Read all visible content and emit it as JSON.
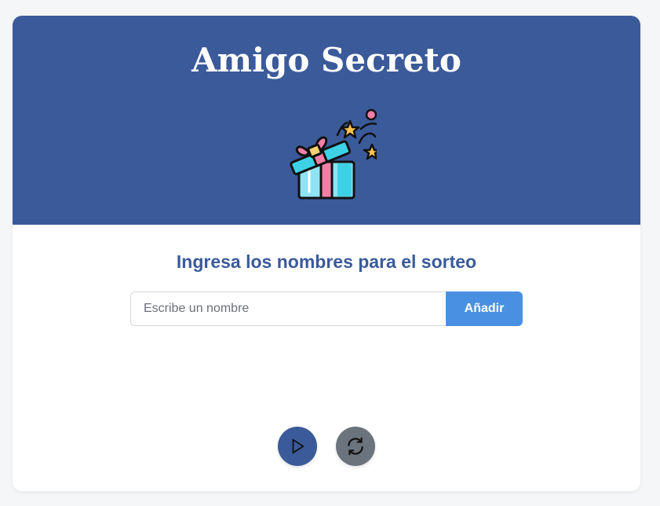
{
  "header": {
    "title": "Amigo Secreto",
    "image_icon": "gift-box-icon"
  },
  "main": {
    "subtitle": "Ingresa los nombres para el sorteo",
    "name_input": {
      "value": "",
      "placeholder": "Escribe un nombre"
    },
    "add_button_label": "Añadir"
  },
  "actions": {
    "draw_button_icon": "play-icon",
    "reset_button_icon": "refresh-icon"
  },
  "colors": {
    "header_bg": "#3b5a9a",
    "accent_blue": "#4a90e2",
    "subtitle_text": "#3b5a9a",
    "play_button_bg": "#3b5a9a",
    "reset_button_bg": "#6b737c",
    "page_bg": "#f5f6f8"
  }
}
